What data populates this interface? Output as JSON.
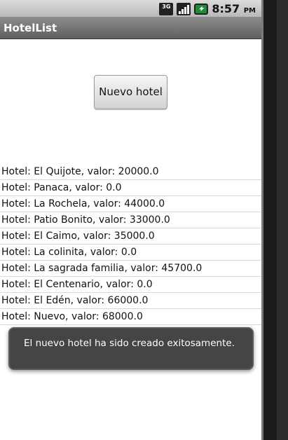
{
  "status_bar": {
    "network_type": "3G",
    "time": "8:57",
    "time_suffix": "PM",
    "icons": [
      "3g-icon",
      "signal-icon",
      "battery-charging-icon"
    ]
  },
  "app": {
    "title": "HotelList"
  },
  "actions": {
    "new_hotel_label": "Nuevo hotel"
  },
  "hotels": [
    "Hotel: El Quijote, valor: 20000.0",
    "Hotel: Panaca, valor: 0.0",
    "Hotel: La Rochela, valor: 44000.0",
    "Hotel: Patio Bonito, valor: 33000.0",
    "Hotel: El Caimo, valor: 35000.0",
    "Hotel: La colinita, valor: 0.0",
    "Hotel: La sagrada familia, valor: 45700.0",
    "Hotel: El Centenario, valor: 0.0",
    "Hotel: El Edén, valor: 66000.0",
    "Hotel: Nuevo, valor: 68000.0"
  ],
  "toast": {
    "message": "El nuevo hotel ha sido creado exitosamente."
  }
}
